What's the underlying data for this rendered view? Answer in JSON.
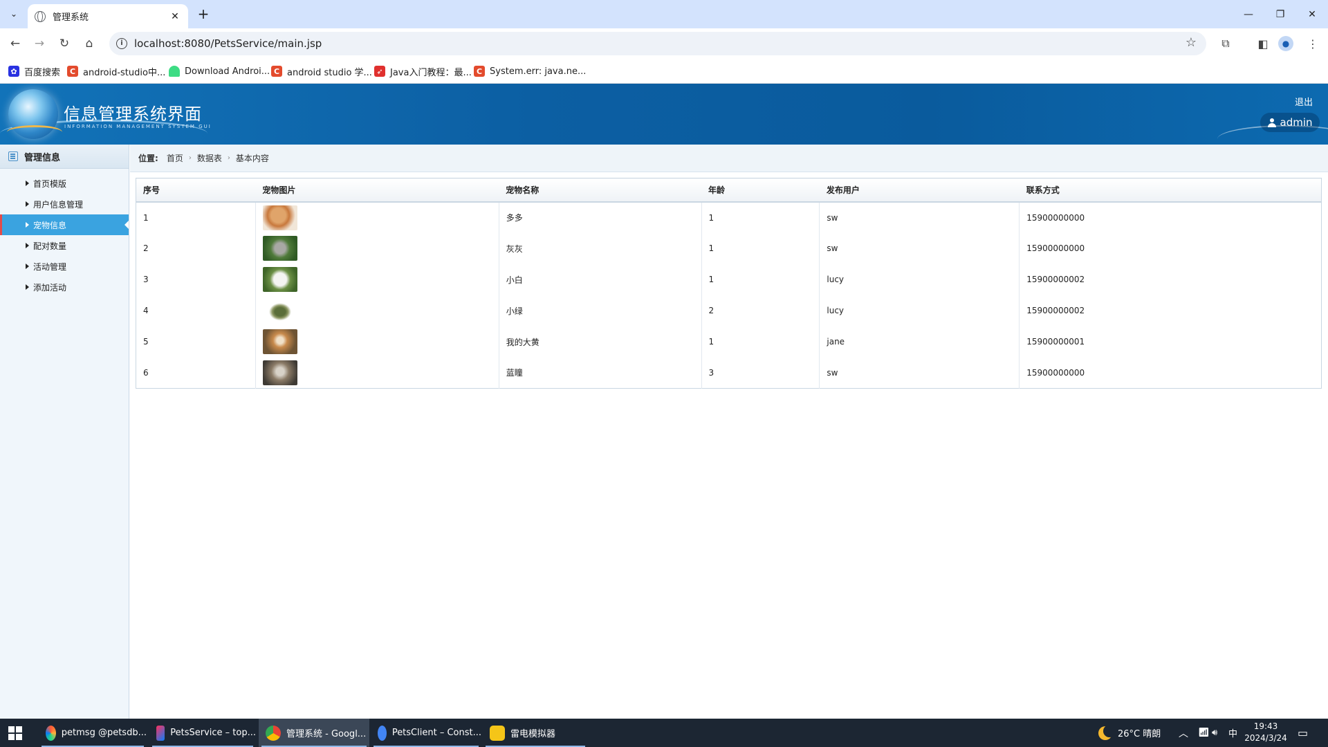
{
  "browser": {
    "tab_title": "管理系统",
    "url": "localhost:8080/PetsService/main.jsp",
    "bookmarks": [
      {
        "label": "百度搜索",
        "icon": "baidu-icon",
        "color": "#2932e1"
      },
      {
        "label": "android-studio中...",
        "icon": "csdn-icon",
        "color": "#e34b2d"
      },
      {
        "label": "Download Androi...",
        "icon": "android-icon",
        "color": "#3ddc84"
      },
      {
        "label": "android studio 学...",
        "icon": "csdn-icon",
        "color": "#e34b2d"
      },
      {
        "label": "Java入门教程：最...",
        "icon": "swift-icon",
        "color": "#e0302e"
      },
      {
        "label": "System.err: java.ne...",
        "icon": "csdn-icon",
        "color": "#e34b2d"
      }
    ]
  },
  "header": {
    "title": "信息管理系统界面",
    "subtitle": "INFORMATION MANAGEMENT SYSTEM GUI",
    "logout_label": "退出",
    "username": "admin",
    "color_primary": "#0c5fa3"
  },
  "sidebar": {
    "heading": "管理信息",
    "items": [
      {
        "label": "首页模版"
      },
      {
        "label": "用户信息管理"
      },
      {
        "label": "宠物信息"
      },
      {
        "label": "配对数量"
      },
      {
        "label": "活动管理"
      },
      {
        "label": "添加活动"
      }
    ],
    "active_index": 2,
    "active_color": "#3aa3e0"
  },
  "breadcrumb": {
    "label": "位置:",
    "crumbs": [
      "首页",
      "数据表",
      "基本内容"
    ]
  },
  "table": {
    "headers": [
      "序号",
      "宠物图片",
      "宠物名称",
      "年龄",
      "发布用户",
      "联系方式"
    ],
    "rows": [
      {
        "id": "1",
        "image": "poodle-photo",
        "name": "多多",
        "age": "1",
        "user": "sw",
        "contact": "15900000000"
      },
      {
        "id": "2",
        "image": "gray-kitten-photo",
        "name": "灰灰",
        "age": "1",
        "user": "sw",
        "contact": "15900000000"
      },
      {
        "id": "3",
        "image": "white-rabbit-photo",
        "name": "小白",
        "age": "1",
        "user": "lucy",
        "contact": "15900000002"
      },
      {
        "id": "4",
        "image": "turtle-photo",
        "name": "小绿",
        "age": "2",
        "user": "lucy",
        "contact": "15900000002"
      },
      {
        "id": "5",
        "image": "shiba-dog-photo",
        "name": "我的大黄",
        "age": "1",
        "user": "jane",
        "contact": "15900000001"
      },
      {
        "id": "6",
        "image": "tabby-cat-photo",
        "name": "蓝瞳",
        "age": "3",
        "user": "sw",
        "contact": "15900000000"
      }
    ]
  },
  "taskbar": {
    "apps": [
      {
        "label": "petmsg @petsdb...",
        "icon": "datagrip-icon"
      },
      {
        "label": "PetsService – top...",
        "icon": "intellij-icon"
      },
      {
        "label": "管理系统 - Googl...",
        "icon": "chrome-icon"
      },
      {
        "label": "PetsClient – Const...",
        "icon": "android-studio-icon"
      },
      {
        "label": "雷电模拟器",
        "icon": "ldplayer-icon"
      }
    ],
    "weather": "26°C  晴朗",
    "ime": "中",
    "time": "19:43",
    "date": "2024/3/24"
  }
}
